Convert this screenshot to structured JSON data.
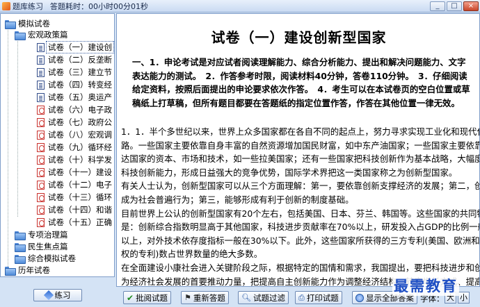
{
  "titlebar": {
    "title": "题库练习",
    "time": "答题耗时：00小时00分01秒",
    "minimize": "_",
    "maximize": "□",
    "close": "×"
  },
  "tree": {
    "root": "模拟试卷",
    "group1": "宏观政策篇",
    "papers": [
      "试卷（一）建设创",
      "试卷（二）反垄断",
      "试卷（三）建立节",
      "试卷（四）转变经",
      "试卷（五）奥运产",
      "试卷（六）电子政",
      "试卷（七）政府公",
      "试卷（八）宏观调",
      "试卷（九）循环经",
      "试卷（十）科学发",
      "试卷（十一）建设",
      "试卷（十二）电子",
      "试卷（十三）循环",
      "试卷（十四）和谐",
      "试卷（十五）正确"
    ],
    "group2": "专项治理篇",
    "group3": "民生焦点篇",
    "group4": "综合模拟试卷",
    "root2": "历年试卷"
  },
  "left_footer": {
    "practice": "练习"
  },
  "document": {
    "title": "试卷（一）建设创新型国家",
    "instructions": "一、1．申论考试是对应试者阅读理解能力、综合分析能力、提出和解决问题能力、文字表达能力的测试。　2．作答参考时限，阅读材料40分钟，答卷110分钟。　3．仔细阅读给定资料，按照后面提出的申论要求依次作答。　4．考生可以在本试卷页的空白位置或草稿纸上打草稿，但所有题目都要在答题纸的指定位置作答，作答在其他位置一律无效。",
    "lines": [
      "1．1．半个多世纪以来，世界上众多国家都在各自不同的起点上，努力寻求实现工业化和现代化的道",
      "路。一些国家主要依靠自身丰富的自然资源增加国民财富，如中东产油国家；一些国家主要依靠发",
      "达国家的资本、市场和技术，如一些拉美国家；还有一些国家把科技创新作为基本战略，大幅度提高",
      "科技创新能力，形成日益强大的竞争优势，国际学术界把这一类国家称之为创新型国家。",
      "有关人士认为，创新型国家可以从三个方面理解：第一，要依靠创新支撑经济的发展；第二，创新要",
      "成为社会普遍行为；第三，能够形成有利于创新的制度基础。",
      "目前世界上公认的创新型国家有20个左右，包括美国、日本、芬兰、韩国等。这些国家的共同特征",
      "是：创新综合指数明显高于其他国家，科技进步贡献率在70%以上，研发投入占GDP的比例一般在2%",
      "以上，对外技术依存度指标一般在30%以下。此外，这些国家所获得的三方专利(美国、欧洲和日本授",
      "权的专利)数占世界数量的绝大多数。",
      "在全面建设小康社会进入关键阶段之际，根据特定的国情和需求，我国提出，要把科技进步和创新作",
      "为经济社会发展的首要推动力量，把提高自主创新能力作为调整经济结构、转变增长方式、提高国家"
    ]
  },
  "toolbar": {
    "grade": "批阅试题",
    "redo": "重新答题",
    "filter": "试题过滤",
    "print": "打印试题",
    "show_answers": "显示全部答案",
    "font_label": "字体：",
    "font_large": "大",
    "font_small": "小"
  },
  "watermark": "最需教育"
}
